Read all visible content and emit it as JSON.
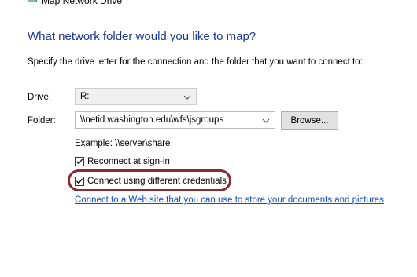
{
  "window": {
    "title": "Map Network Drive",
    "icon": "network-drive-icon"
  },
  "heading": "What network folder would you like to map?",
  "instruction": "Specify the drive letter for the connection and the folder that you want to connect to:",
  "drive": {
    "label": "Drive:",
    "value": "R:",
    "icon": "chevron-down-icon"
  },
  "folder": {
    "label": "Folder:",
    "value": "\\\\netid.washington.edu\\wfs\\jsgroups",
    "icon": "chevron-down-icon"
  },
  "browse_label": "Browse...",
  "example": "Example: \\\\server\\share",
  "reconnect": {
    "label": "Reconnect at sign-in",
    "checked": true
  },
  "credentials": {
    "label": "Connect using different credentials",
    "checked": true,
    "highlight_color": "#8a2a32"
  },
  "web_link": "Connect to a Web site that you can use to store your documents and pictures",
  "colors": {
    "heading": "#1a3796",
    "link": "#0d4fc9"
  }
}
